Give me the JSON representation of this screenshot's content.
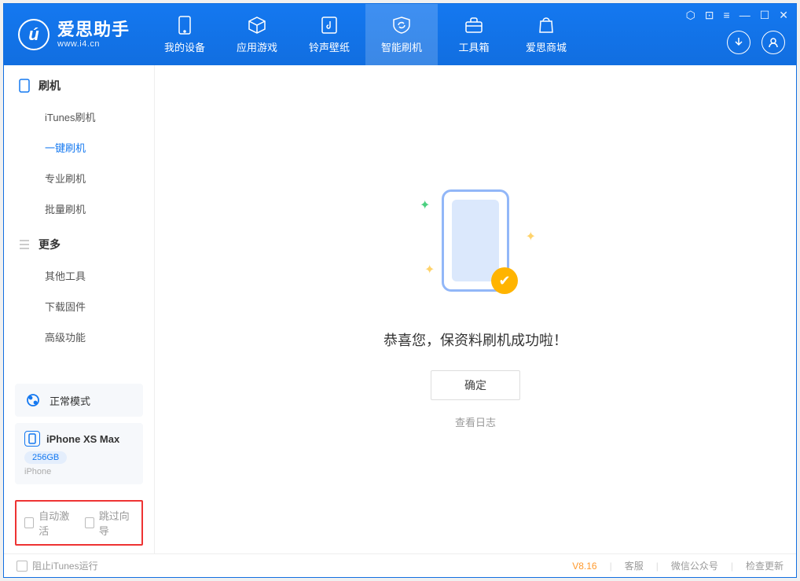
{
  "brand": {
    "title": "爱思助手",
    "subtitle": "www.i4.cn"
  },
  "tabs": [
    {
      "label": "我的设备",
      "icon": "device"
    },
    {
      "label": "应用游戏",
      "icon": "cube"
    },
    {
      "label": "铃声壁纸",
      "icon": "music"
    },
    {
      "label": "智能刷机",
      "icon": "refresh",
      "active": true
    },
    {
      "label": "工具箱",
      "icon": "toolbox"
    },
    {
      "label": "爱思商城",
      "icon": "bag"
    }
  ],
  "sidebar": {
    "group1": {
      "title": "刷机",
      "items": [
        "iTunes刷机",
        "一键刷机",
        "专业刷机",
        "批量刷机"
      ],
      "activeIndex": 1
    },
    "group2": {
      "title": "更多",
      "items": [
        "其他工具",
        "下载固件",
        "高级功能"
      ]
    },
    "mode": {
      "label": "正常模式"
    },
    "device": {
      "name": "iPhone XS Max",
      "capacity": "256GB",
      "type": "iPhone"
    },
    "options": {
      "opt1": "自动激活",
      "opt2": "跳过向导"
    }
  },
  "main": {
    "message": "恭喜您，保资料刷机成功啦！",
    "confirm": "确定",
    "viewLog": "查看日志"
  },
  "footer": {
    "blockItunes": "阻止iTunes运行",
    "version": "V8.16",
    "links": [
      "客服",
      "微信公众号",
      "检查更新"
    ]
  }
}
